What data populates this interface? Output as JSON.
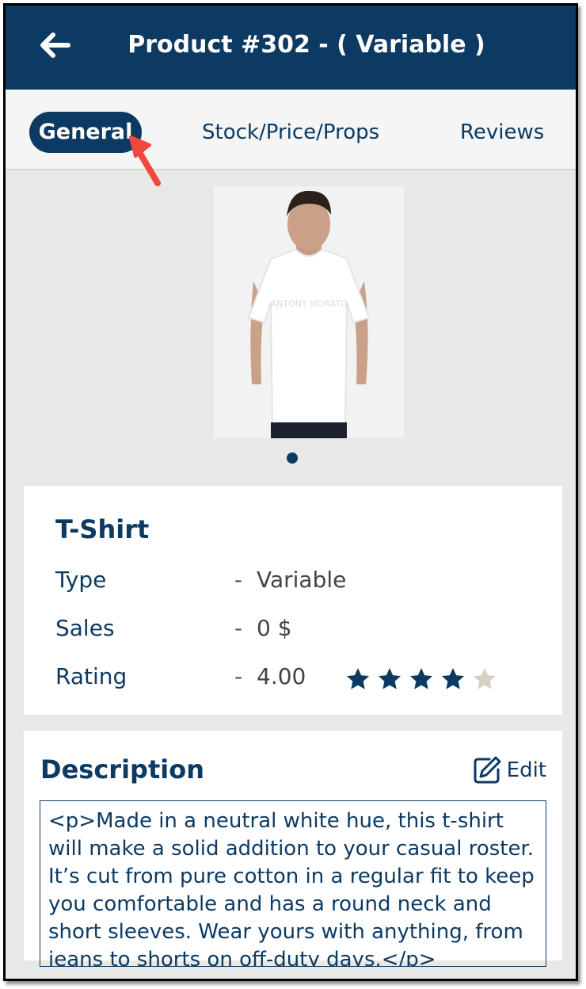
{
  "header": {
    "title": "Product #302 - ( Variable )",
    "back_icon": "arrow-left-icon"
  },
  "tabs": [
    {
      "label": "General",
      "active": true
    },
    {
      "label": "Stock/Price/Props",
      "active": false
    },
    {
      "label": "Reviews",
      "active": false
    }
  ],
  "gallery": {
    "image": "white-t-shirt-model-photo",
    "pages": 1,
    "current_page": 1
  },
  "product": {
    "name": "T-Shirt",
    "rows": [
      {
        "label": "Type",
        "dash": "-",
        "value": "Variable"
      },
      {
        "label": "Sales",
        "dash": "-",
        "value": "0 $"
      },
      {
        "label": "Rating",
        "dash": "-",
        "value": "4.00"
      }
    ],
    "rating_stars": 4,
    "rating_max": 5
  },
  "description": {
    "title": "Description",
    "edit_label": "Edit",
    "edit_icon": "edit-pencil-icon",
    "text": "<p>Made in a neutral white hue, this t-shirt will make a solid addition to your casual roster. It’s cut from pure cotton in a regular fit to keep you comfortable and has a round neck and short sleeves. Wear yours with anything, from jeans to shorts on off-duty days.</p>"
  },
  "colors": {
    "primary": "#0d3a63",
    "star_filled": "#0d3a63",
    "star_empty": "#d6cfc2",
    "annotation_arrow": "#f0473f"
  }
}
